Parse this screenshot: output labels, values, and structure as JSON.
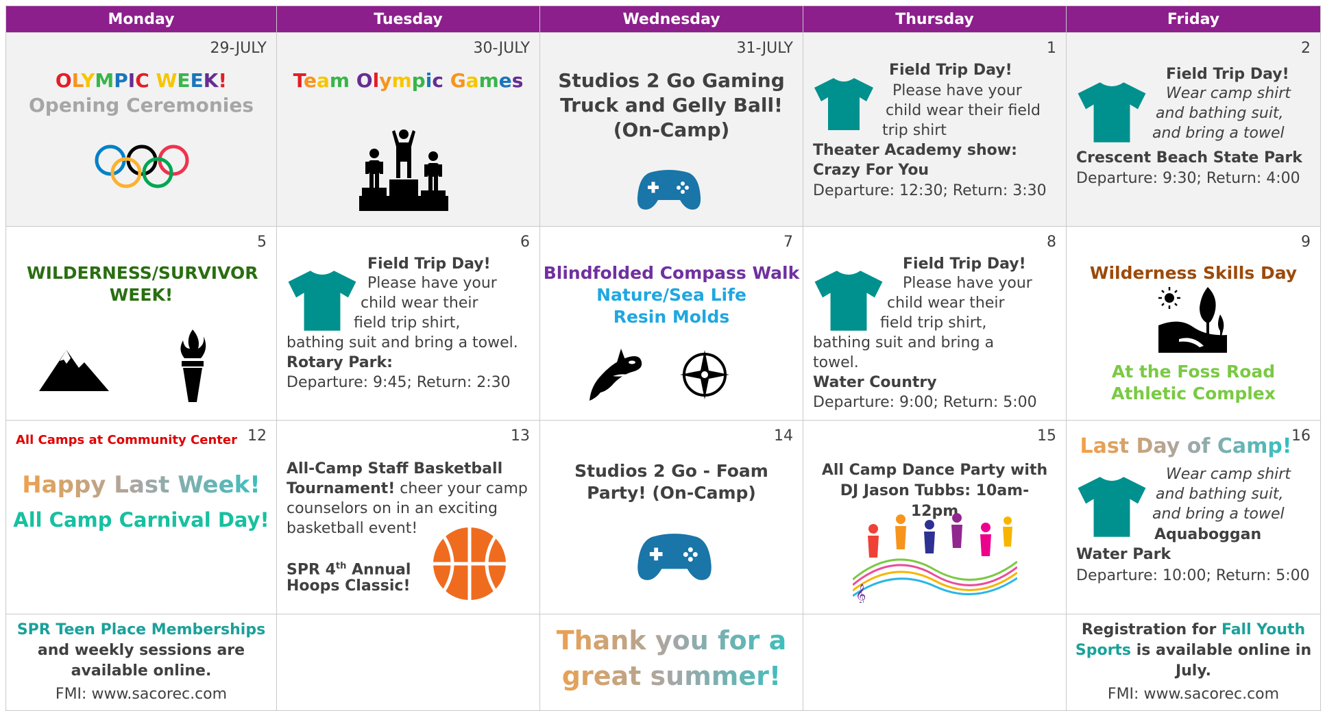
{
  "colors": {
    "header_bg": "#8c1f8c",
    "teal": "#00918e",
    "green_dark": "#2a6e12",
    "orange_brown": "#9c4a0a",
    "lime": "#7ac943",
    "purple": "#7030a0",
    "cyan": "#1fa7e0",
    "red": "#e00000",
    "teal_link": "#1aa19a"
  },
  "days": [
    "Monday",
    "Tuesday",
    "Wednesday",
    "Thursday",
    "Friday"
  ],
  "row1": {
    "mon": {
      "date": "29-JULY",
      "title": "OLYMPIC WEEK!",
      "subtitle": "Opening Ceremonies"
    },
    "tue": {
      "date": "30-JULY",
      "title": "Team Olympic Games"
    },
    "wed": {
      "date": "31-JULY",
      "title": "Studios 2 Go Gaming Truck and Gelly Ball! (On-Camp)"
    },
    "thu": {
      "date": "1",
      "heading": "Field Trip Day!",
      "line1": "Please have your",
      "line2": "child wear their field",
      "line3": "trip shirt",
      "show": "Theater Academy show:",
      "show_name": "Crazy For You",
      "times": "Departure: 12:30; Return: 3:30"
    },
    "fri": {
      "date": "2",
      "heading": "Field Trip Day!",
      "line1": "Wear camp shirt",
      "line2": "and bathing suit,",
      "line3": "and bring a towel",
      "place": "Crescent Beach State Park",
      "times": "Departure: 9:30; Return: 4:00"
    }
  },
  "row2": {
    "mon": {
      "date": "5",
      "title": "WILDERNESS/SURVIVOR WEEK!"
    },
    "tue": {
      "date": "6",
      "heading": "Field Trip Day!",
      "line1": "Please have your",
      "line2": "child wear their",
      "line3": "field trip shirt,",
      "line4": "bathing suit and bring a towel.",
      "place": "Rotary Park:",
      "times": "Departure: 9:45; Return: 2:30"
    },
    "wed": {
      "date": "7",
      "title1": "Blindfolded Compass Walk",
      "title2": "Nature/Sea Life Resin Molds"
    },
    "thu": {
      "date": "8",
      "heading": "Field Trip Day!",
      "line1": "Please have your",
      "line2": "child wear their",
      "line3": "field trip shirt,",
      "line4": "bathing suit and bring a",
      "line5": "towel.",
      "place": "Water Country",
      "times": "Departure: 9:00; Return: 5:00"
    },
    "fri": {
      "date": "9",
      "title": "Wilderness Skills Day",
      "location": "At the Foss Road Athletic Complex"
    }
  },
  "row3": {
    "mon": {
      "date": "12",
      "note": "All Camps at Community Center",
      "title1": "Happy Last Week!",
      "title2": "All Camp Carnival Day!"
    },
    "tue": {
      "date": "13",
      "bold1": "All-Camp Staff Basketball",
      "bold2": "Tournament!",
      "rest1": " cheer your camp",
      "rest2": "counselors on in an exciting",
      "rest3": "basketball event!",
      "hoops1": "SPR 4",
      "hoops_sup": "th",
      "hoops2": " Annual",
      "hoops3": "Hoops Classic!"
    },
    "wed": {
      "date": "14",
      "title": "Studios 2 Go - Foam Party! (On-Camp)"
    },
    "thu": {
      "date": "15",
      "title": "All Camp Dance Party with DJ Jason Tubbs: 10am-12pm"
    },
    "fri": {
      "date": "16",
      "title": "Last Day of Camp!",
      "line1": "Wear camp shirt",
      "line2": "and bathing suit,",
      "line3": "and bring a towel",
      "place1": "Aquaboggan",
      "place2": "Water Park",
      "times": "Departure: 10:00; Return: 5:00"
    }
  },
  "row4": {
    "mon": {
      "link": "SPR Teen Place Memberships",
      "line2": "and weekly sessions are",
      "line3": "available online.",
      "fmi": "FMI: www.sacorec.com"
    },
    "wed": {
      "title1": "Thank you for a",
      "title2": "great summer!"
    },
    "fri": {
      "pre": "Registration for ",
      "link1": "Fall Youth",
      "link2": "Sports",
      "post": " is available online in",
      "post2": "July.",
      "fmi": "FMI: www.sacorec.com"
    }
  },
  "icons": [
    "olympic-rings-icon",
    "podium-icon",
    "gamepad-icon",
    "tshirt-icon",
    "mountain-icon",
    "torch-icon",
    "orca-icon",
    "compass-icon",
    "sun-tree-icon",
    "basketball-icon",
    "dancers-icon"
  ]
}
